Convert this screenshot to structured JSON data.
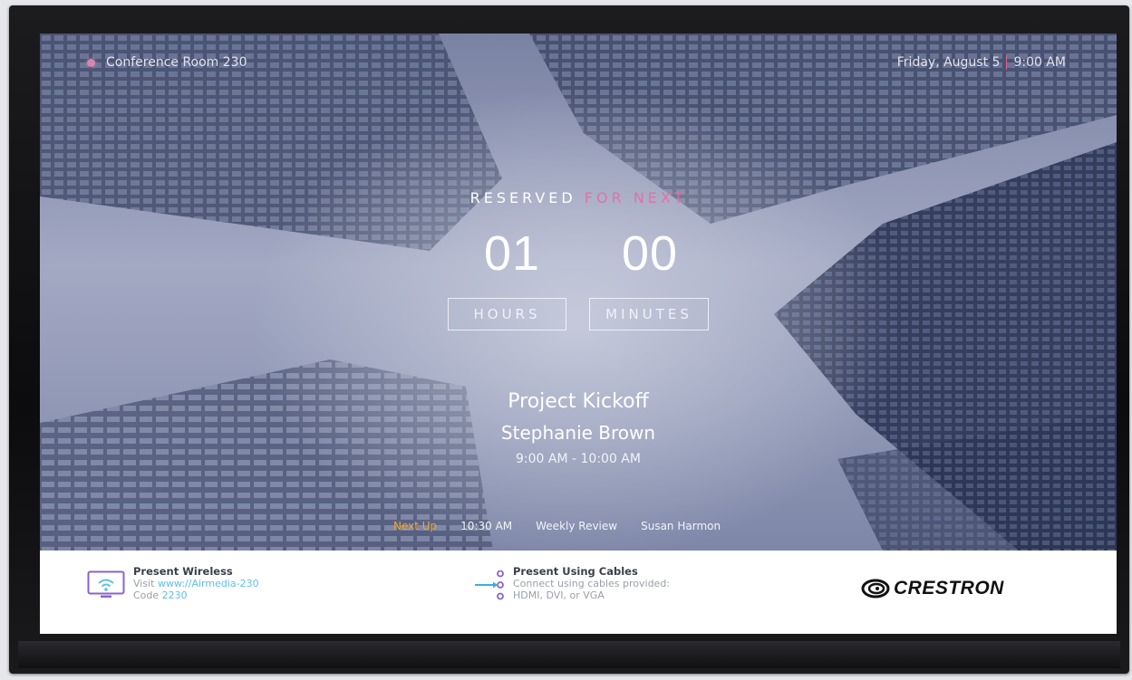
{
  "header": {
    "room_name": "Conference Room 230",
    "date": "Friday, August 5",
    "time": "9:00 AM"
  },
  "status": {
    "label_main": "RESERVED",
    "label_accent": "FOR NEXT",
    "hours_value": "01",
    "minutes_value": "00",
    "hours_label": "HOURS",
    "minutes_label": "MINUTES"
  },
  "meeting": {
    "title": "Project Kickoff",
    "organizer": "Stephanie Brown",
    "time_range": "9:00 AM - 10:00 AM"
  },
  "next_up": {
    "label": "Next Up",
    "time": "10:30 AM",
    "title": "Weekly Review",
    "organizer": "Susan Harmon"
  },
  "wireless": {
    "heading": "Present Wireless",
    "visit_prefix": "Visit",
    "url": "www://Airmedia-230",
    "code_prefix": "Code",
    "code": "2230"
  },
  "cables": {
    "heading": "Present Using Cables",
    "line1": "Connect using cables provided:",
    "line2": "HDMI, DVI, or VGA"
  },
  "brand": {
    "name": "CRESTRON"
  },
  "colors": {
    "accent_pink": "#e96aa4",
    "next_up_orange": "#f1a630",
    "link_blue": "#5bc0e6",
    "icon_purple": "#8a63c9"
  }
}
